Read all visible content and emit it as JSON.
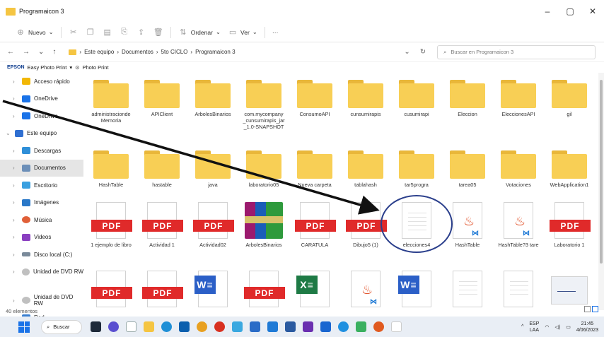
{
  "window": {
    "title": "Programaicon 3",
    "minimize": "–",
    "maximize": "▢",
    "close": "✕"
  },
  "commands": {
    "new": "Nuevo",
    "sort": "Ordenar",
    "view": "Ver",
    "more": "···"
  },
  "address": {
    "crumbs": [
      "Este equipo",
      "Documentos",
      "5to CICLO",
      "Programaicon 3"
    ],
    "search_placeholder": "Buscar en Programaicon 3"
  },
  "epson": {
    "brand": "EPSON",
    "label": "Easy Photo Print",
    "extra": "Photo Print"
  },
  "sidebar": {
    "items": [
      {
        "label": "Acceso rápido",
        "color": "#f2b705"
      },
      {
        "label": "OneDrive",
        "color": "#1a73e8"
      },
      {
        "label": "OneDrive",
        "color": "#1a73e8"
      },
      {
        "label": "Este equipo",
        "color": "#2f6fd1"
      },
      {
        "label": "Descargas",
        "color": "#2f8fd8"
      },
      {
        "label": "Documentos",
        "color": "#6c8fb8"
      },
      {
        "label": "Escritorio",
        "color": "#3aa0e0"
      },
      {
        "label": "Imágenes",
        "color": "#2a78c8"
      },
      {
        "label": "Música",
        "color": "#e06038"
      },
      {
        "label": "Videos",
        "color": "#8a3fc0"
      },
      {
        "label": "Disco local (C:)",
        "color": "#7a8a9a"
      },
      {
        "label": "Unidad de DVD RW",
        "color": "#c0c0c0"
      },
      {
        "label": "Unidad de DVD RW",
        "color": "#c0c0c0"
      },
      {
        "label": "Red",
        "color": "#3a7fd0"
      }
    ]
  },
  "files": {
    "row1": [
      "administracionde Memoria",
      "APIClient",
      "ArbolesBinarios",
      "com.mycompany _cunsumirapis_jar _1.0-SNAPSHOT",
      "ConsumoAPI",
      "cunsumirapis",
      "cusumirapi",
      "Eleccion",
      "EleccionesAPI",
      "gil"
    ],
    "row2": [
      "HashTable",
      "hastable",
      "java",
      "laboratorio05",
      "Nueva carpeta",
      "tablahash",
      "tar5progra",
      "tarea05",
      "Votaciones",
      "WebApplication1"
    ],
    "row3": [
      "1 ejemplo de libro",
      "Actividad 1",
      "Actividad02",
      "ArbolesBinarios",
      "CARATULA",
      "Dibujo5 (1)",
      "elecciones4",
      "HashTable",
      "HashTable?3 tare",
      "Laboratorio 1"
    ],
    "row3_badges": [
      "PDF",
      "PDF",
      "PDF",
      "",
      "PDF",
      "PDF",
      "",
      "",
      "",
      "PDF"
    ],
    "row4_badges": [
      "PDF",
      "PDF",
      "W≡",
      "PDF",
      "X≡",
      "",
      "W≡",
      "",
      "",
      ""
    ]
  },
  "status": {
    "count": "40 elementos"
  },
  "taskbar": {
    "search": "Buscar",
    "lang1": "ESP",
    "lang2": "LAA",
    "time": "21:45",
    "date": "4/06/2023"
  }
}
